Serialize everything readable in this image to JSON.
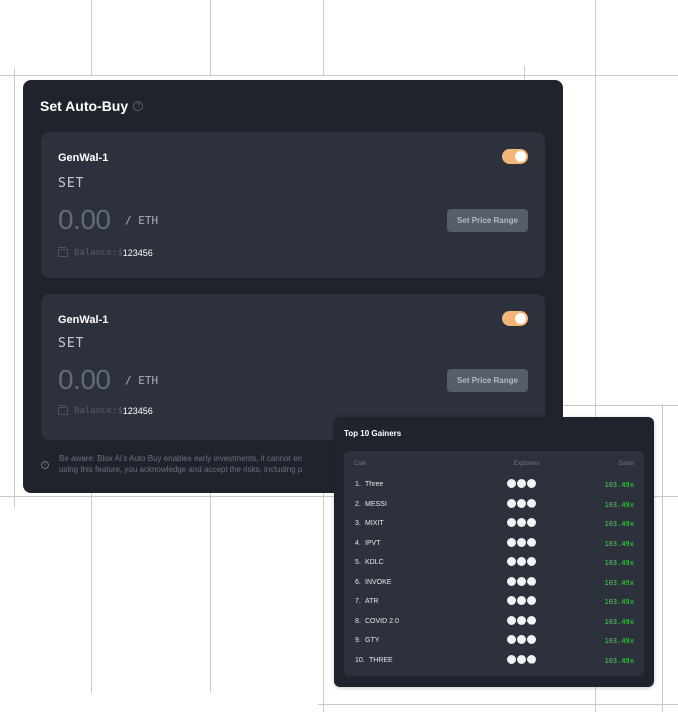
{
  "auto_buy": {
    "title": "Set Auto-Buy",
    "help_icon": "?",
    "wallets": [
      {
        "name": "GenWal-1",
        "set_label": "SET",
        "amount": "0.00",
        "unit": "/ ETH",
        "range_button": "Set Price Range",
        "balance_label": "Balance:",
        "currency": "$",
        "balance": "123456",
        "toggle_on": true
      },
      {
        "name": "GenWal-1",
        "set_label": "SET",
        "amount": "0.00",
        "unit": "/ ETH",
        "range_button": "Set Price Range",
        "balance_label": "Balance:",
        "currency": "$",
        "balance": "123456",
        "toggle_on": true
      }
    ],
    "notice_line1": "Be aware: Blox Ai's Auto Buy enables early investments, it cannot en",
    "notice_line2": "using this feature, you acknowledge and accept the risks, including p"
  },
  "gainers": {
    "title": "Top 10 Gainers",
    "columns": [
      "Coin",
      "Explorers",
      "Gains"
    ],
    "rows": [
      {
        "rank": "1.",
        "name": "Three",
        "gain": "103.49x"
      },
      {
        "rank": "2.",
        "name": "MESSI",
        "gain": "103.49x"
      },
      {
        "rank": "3.",
        "name": "MIXIT",
        "gain": "103.49x"
      },
      {
        "rank": "4.",
        "name": "IPVT",
        "gain": "103.49x"
      },
      {
        "rank": "5.",
        "name": "KDLC",
        "gain": "103.49x"
      },
      {
        "rank": "6.",
        "name": "INVOKE",
        "gain": "103.49x"
      },
      {
        "rank": "7.",
        "name": "ATR",
        "gain": "103.49x"
      },
      {
        "rank": "8.",
        "name": "COVID 2.0",
        "gain": "103.49x"
      },
      {
        "rank": "9.",
        "name": "GTY",
        "gain": "103.49x"
      },
      {
        "rank": "10.",
        "name": "THREE",
        "gain": "103.49x"
      }
    ],
    "explorer_icons": [
      "explorer-icon-1",
      "explorer-icon-2",
      "explorer-icon-3"
    ]
  },
  "colors": {
    "accent_toggle": "#f1b678",
    "gain_green": "#45d34e",
    "panel_bg": "#1f232b",
    "card_bg": "#2c313b"
  }
}
